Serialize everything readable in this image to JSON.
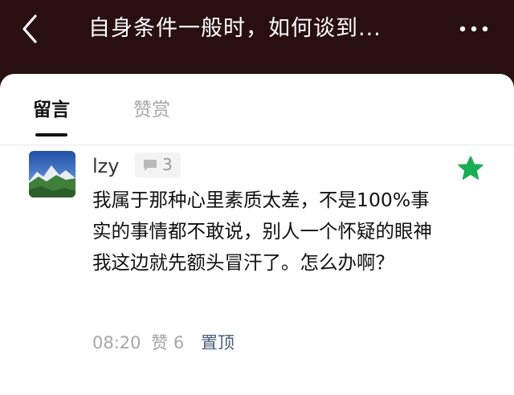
{
  "header": {
    "title": "自身条件一般时，如何谈到...",
    "back_icon": "chevron-left-icon",
    "more_icon": "more-dots-icon"
  },
  "tabs": [
    {
      "label": "留言",
      "active": true
    },
    {
      "label": "赞赏",
      "active": false
    }
  ],
  "comment": {
    "avatar_icon": "mountain-landscape-avatar",
    "username": "lzy",
    "reply_count": "3",
    "starred": true,
    "text": "我属于那种心里素质太差，不是100%事实的事情都不敢说，别人一个怀疑的眼神我这边就先额头冒汗了。怎么办啊？",
    "time": "08:20",
    "likes_label": "赞 6",
    "pin_label": "置顶"
  },
  "colors": {
    "header_bg": "#2a0f11",
    "star": "#1aad55",
    "pin_link": "#4a5d7a"
  }
}
